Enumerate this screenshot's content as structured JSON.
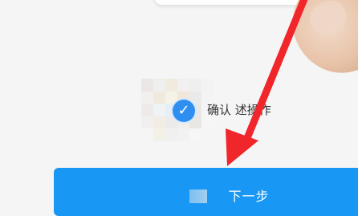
{
  "confirm": {
    "label": "确认上述操作",
    "partial_visible": "确认 述操作",
    "checked": true
  },
  "next_button": {
    "label": "下一步"
  },
  "colors": {
    "accent": "#1898f4",
    "checkbox": "#2f8ff0",
    "annotation_arrow": "#f0262b"
  },
  "icons": {
    "check": "checkmark-icon",
    "arrow": "red-arrow-annotation"
  }
}
